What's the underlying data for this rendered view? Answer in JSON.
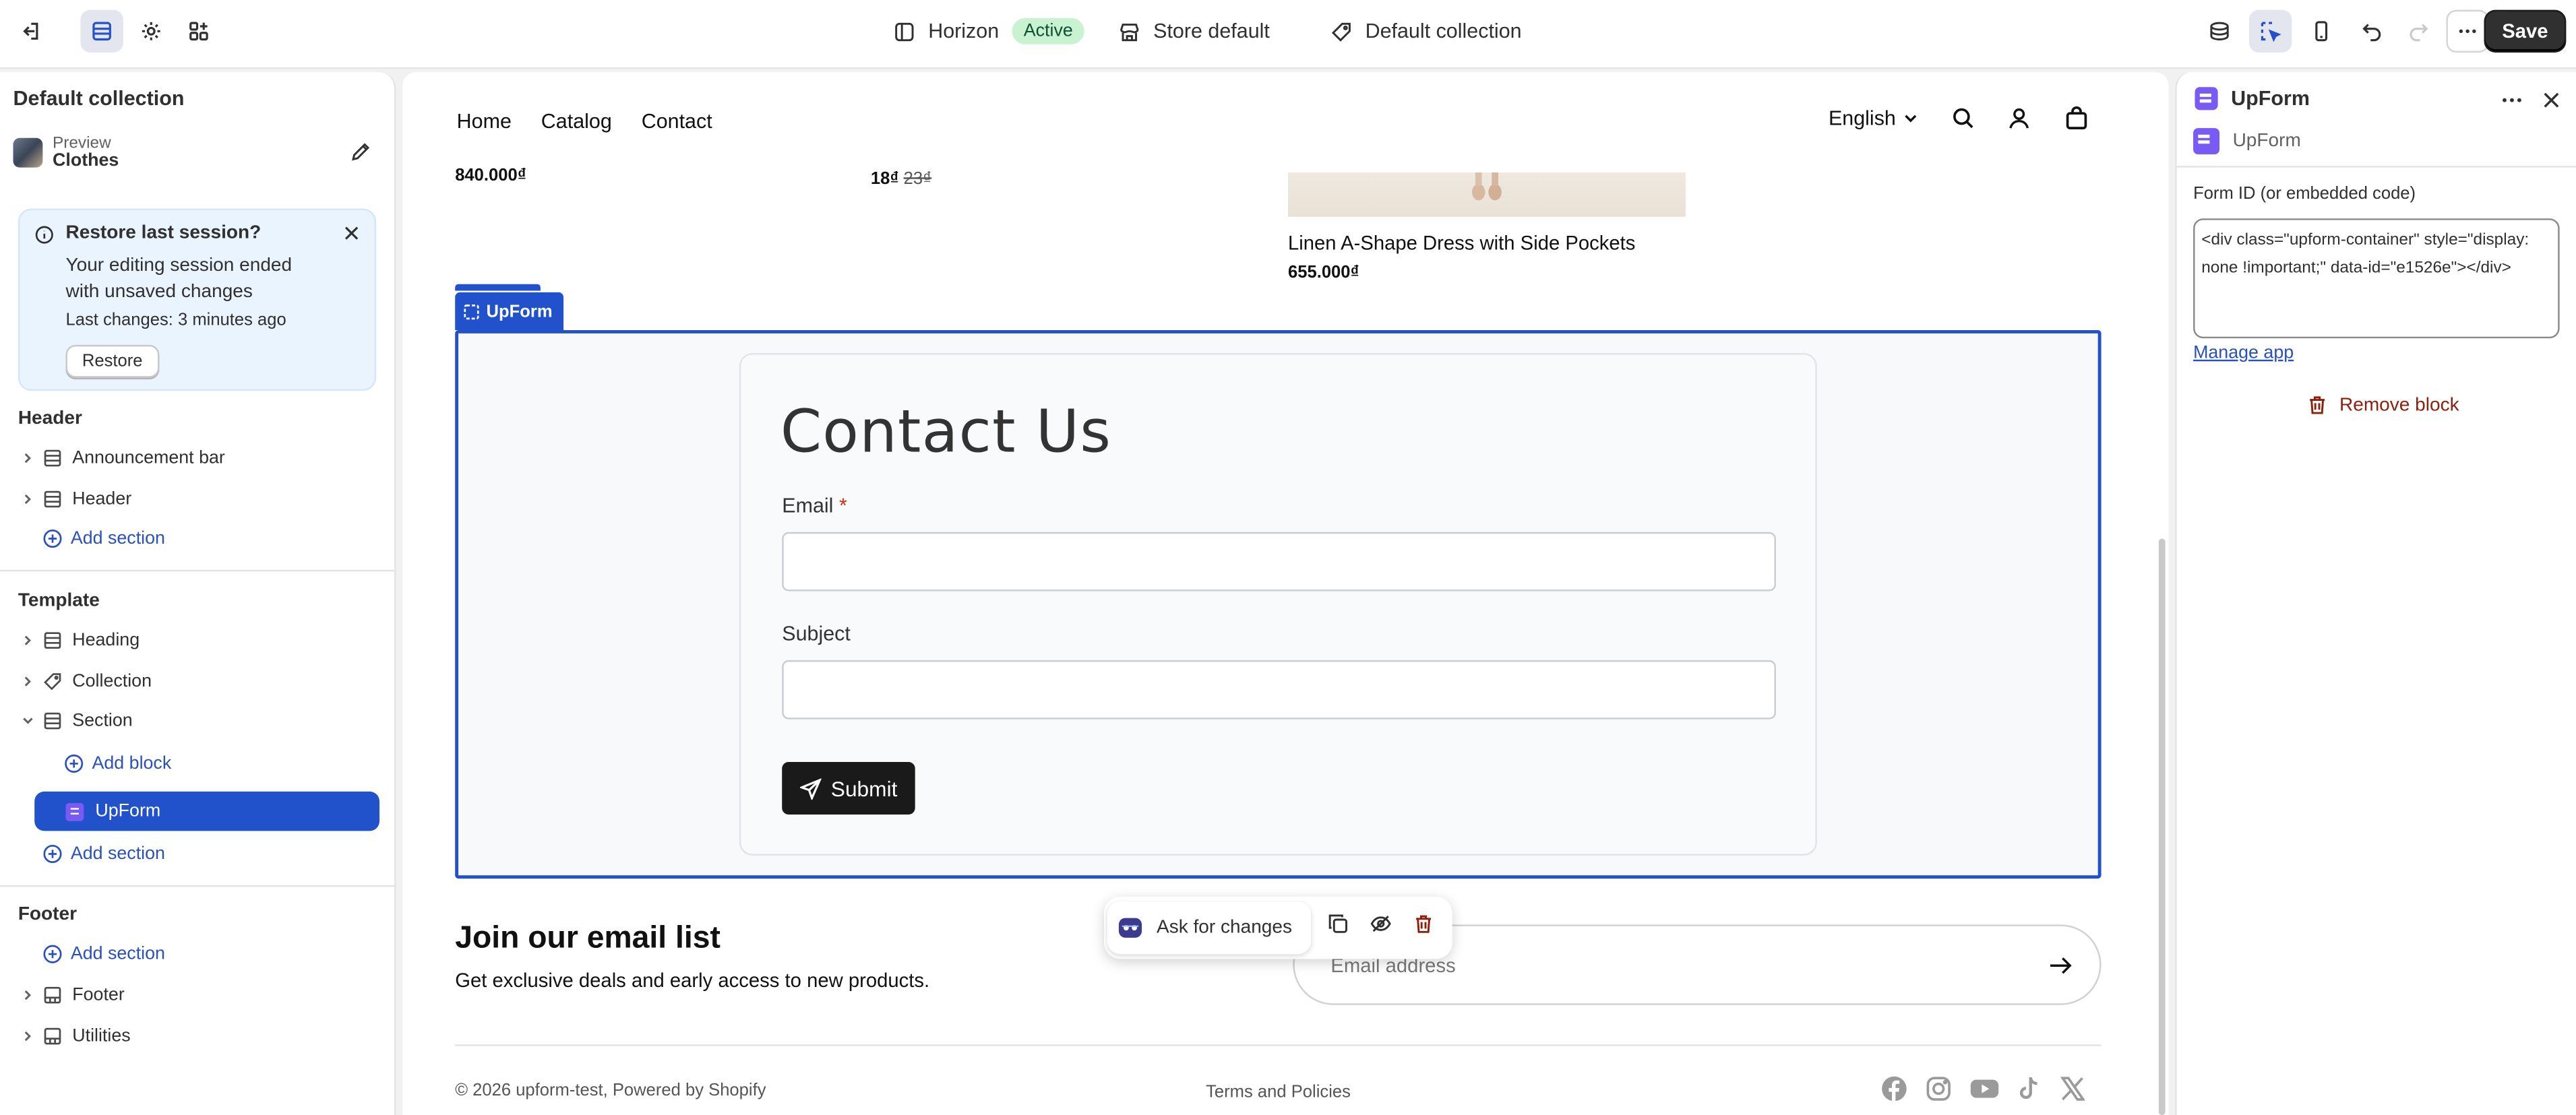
{
  "topbar": {
    "theme_name": "Horizon",
    "theme_status": "Active",
    "store": "Store default",
    "template": "Default collection",
    "save_label": "Save"
  },
  "sidebar": {
    "title": "Default collection",
    "preview_label": "Preview",
    "preview_value": "Clothes",
    "restore": {
      "title": "Restore last session?",
      "body": "Your editing session ended with unsaved changes",
      "last_changes": "Last changes: 3 minutes ago",
      "button": "Restore"
    },
    "header_group": {
      "title": "Header",
      "items": [
        "Announcement bar",
        "Header"
      ],
      "add": "Add section"
    },
    "template_group": {
      "title": "Template",
      "items": [
        "Heading",
        "Collection",
        "Section"
      ],
      "add_block": "Add block",
      "selected_block": "UpForm",
      "add": "Add section"
    },
    "footer_group": {
      "title": "Footer",
      "add": "Add section",
      "items": [
        "Footer",
        "Utilities"
      ]
    }
  },
  "canvas": {
    "nav": [
      "Home",
      "Catalog",
      "Contact"
    ],
    "language": "English",
    "cut_price_1": "840.000₫",
    "cut_price_2_sale": "18₫",
    "cut_price_2_compare": "23₫",
    "product_title": "Linen A-Shape Dress with Side Pockets",
    "product_price": "655.000₫",
    "block_tab": "UpForm",
    "form": {
      "heading": "Contact Us",
      "email_label": "Email",
      "required_mark": "*",
      "subject_label": "Subject",
      "submit": "Submit"
    },
    "newsletter": {
      "title": "Join our email list",
      "subtitle": "Get exclusive deals and early access to new products.",
      "placeholder": "Email address"
    },
    "footer": {
      "copyright": "© 2026 upform-test, Powered by Shopify",
      "terms": "Terms and Policies"
    },
    "floating_bar": {
      "ask": "Ask for changes"
    }
  },
  "rpanel": {
    "title": "UpForm",
    "app_name": "UpForm",
    "field_label": "Form ID (or embedded code)",
    "field_value": "<div class=\"upform-container\" style=\"display: none !important;\" data-id=\"e1526e\"></div>",
    "manage_link": "Manage app",
    "remove": "Remove block"
  },
  "colors": {
    "accent": "#2251cc",
    "save_bg": "#303030",
    "active_badge": "#c9f2d0",
    "restore_bg": "#eaf4ff",
    "app_icon": "#7a5af5",
    "danger": "#8e1f0b"
  }
}
